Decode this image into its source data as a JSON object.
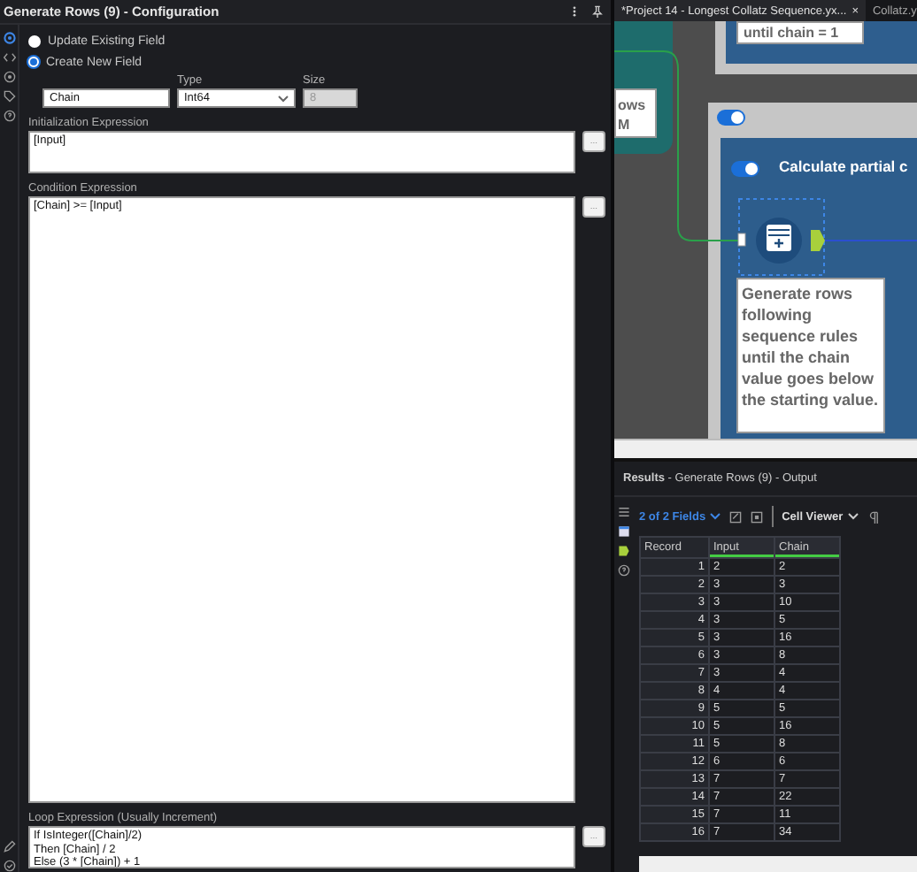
{
  "config": {
    "title": "Generate Rows (9) - Configuration",
    "radios": [
      {
        "label": "Update Existing Field",
        "selected": false
      },
      {
        "label": "Create New  Field",
        "selected": true
      }
    ],
    "name_value": "Chain",
    "type_label": "Type",
    "type_value": "Int64",
    "size_label": "Size",
    "size_value": "8",
    "size_disabled": true,
    "expressions": [
      {
        "label": "Initialization Expression",
        "lines": [
          "[Input]"
        ],
        "button": "...",
        "kind": "short"
      },
      {
        "label": "Condition Expression",
        "lines": [
          "[Chain] >= [Input]"
        ],
        "button": "...",
        "kind": "grow"
      },
      {
        "label": "Loop Expression (Usually Increment)",
        "lines": [
          "If IsInteger([Chain]/2)",
          "Then [Chain] / 2",
          "Else (3 * [Chain]) + 1"
        ],
        "button": "...",
        "kind": "short"
      }
    ]
  },
  "tabs": [
    {
      "label": "*Project 14 - Longest Collatz Sequence.yx...",
      "close": "×",
      "selected": true
    },
    {
      "label": "Collatz.y",
      "selected": false
    }
  ],
  "canvas": {
    "top_note": "until chain = 1",
    "left_note": [
      "ows",
      "M"
    ],
    "container_toggle_on": true,
    "container_title": "Calculate partial c",
    "inner_toggle_on": true,
    "annotation": "Generate rows following sequence rules until the chain value goes below the starting value."
  },
  "results": {
    "title": "Results",
    "subtitle": " - Generate Rows (9) - Output",
    "fields": "2 of 2 Fields",
    "viewer": "Cell Viewer",
    "columns": [
      "Record",
      "Input",
      "Chain"
    ],
    "rows": [
      [
        "1",
        "2",
        "2"
      ],
      [
        "2",
        "3",
        "3"
      ],
      [
        "3",
        "3",
        "10"
      ],
      [
        "4",
        "3",
        "5"
      ],
      [
        "5",
        "3",
        "16"
      ],
      [
        "6",
        "3",
        "8"
      ],
      [
        "7",
        "3",
        "4"
      ],
      [
        "8",
        "4",
        "4"
      ],
      [
        "9",
        "5",
        "5"
      ],
      [
        "10",
        "5",
        "16"
      ],
      [
        "11",
        "5",
        "8"
      ],
      [
        "12",
        "6",
        "6"
      ],
      [
        "13",
        "7",
        "7"
      ],
      [
        "14",
        "7",
        "22"
      ],
      [
        "15",
        "7",
        "11"
      ],
      [
        "16",
        "7",
        "34"
      ]
    ]
  }
}
